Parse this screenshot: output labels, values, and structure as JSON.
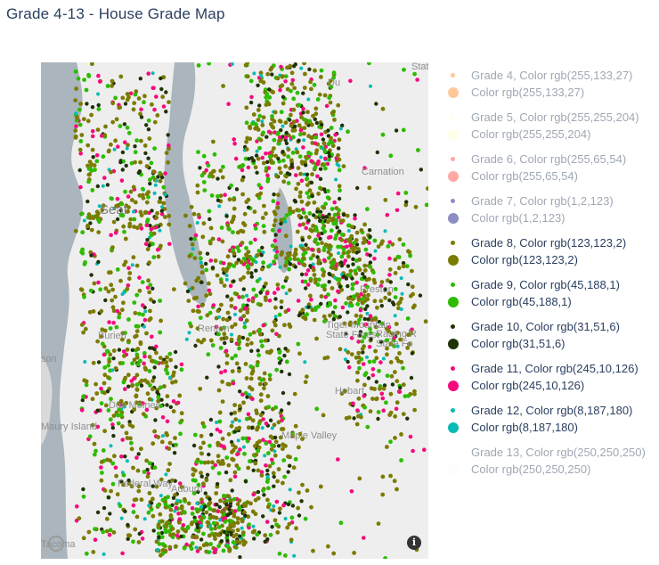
{
  "title": "Grade 4-13 - House Grade Map",
  "map": {
    "background": "#eeeeee",
    "water": "#aab5bd",
    "places": [
      {
        "name": "Stat",
        "size": "small"
      },
      {
        "name": "Du",
        "size": "small"
      },
      {
        "name": "Carnation",
        "size": "small"
      },
      {
        "name": "Seat",
        "size": "big"
      },
      {
        "name": "Preston",
        "size": "small"
      },
      {
        "name": "Tiger Mountain\nState Forest",
        "size": "small"
      },
      {
        "name": "Raging R\nState Fo",
        "size": "small"
      },
      {
        "name": "Renton",
        "size": "small"
      },
      {
        "name": "Burien",
        "size": "small"
      },
      {
        "name": "son",
        "size": "small"
      },
      {
        "name": "Hobart",
        "size": "small"
      },
      {
        "name": "Des Moines",
        "size": "small"
      },
      {
        "name": "Maple Valley",
        "size": "small"
      },
      {
        "name": "Maury Island",
        "size": "small"
      },
      {
        "name": "Federal Way",
        "size": "small"
      },
      {
        "name": "Auburn",
        "size": "small"
      },
      {
        "name": "Tacoma",
        "size": "small"
      }
    ],
    "info_label": "i"
  },
  "legend": [
    {
      "grade_label": "Grade 4, Color rgb(255,133,27)",
      "color_label": "Color rgb(255,133,27)",
      "color": "#ff851b",
      "active": false
    },
    {
      "grade_label": "Grade 5, Color rgb(255,255,204)",
      "color_label": "Color rgb(255,255,204)",
      "color": "#ffffcc",
      "active": false
    },
    {
      "grade_label": "Grade 6, Color rgb(255,65,54)",
      "color_label": "Color rgb(255,65,54)",
      "color": "#ff4136",
      "active": false
    },
    {
      "grade_label": "Grade 7, Color rgb(1,2,123)",
      "color_label": "Color rgb(1,2,123)",
      "color": "#01027b",
      "active": false
    },
    {
      "grade_label": "Grade 8, Color rgb(123,123,2)",
      "color_label": "Color rgb(123,123,2)",
      "color": "#7b7b02",
      "active": true
    },
    {
      "grade_label": "Grade 9, Color rgb(45,188,1)",
      "color_label": "Color rgb(45,188,1)",
      "color": "#2dbc01",
      "active": true
    },
    {
      "grade_label": "Grade 10, Color rgb(31,51,6)",
      "color_label": "Color rgb(31,51,6)",
      "color": "#1f3306",
      "active": true
    },
    {
      "grade_label": "Grade 11, Color rgb(245,10,126)",
      "color_label": "Color rgb(245,10,126)",
      "color": "#f50a7e",
      "active": true
    },
    {
      "grade_label": "Grade 12, Color rgb(8,187,180)",
      "color_label": "Color rgb(8,187,180)",
      "color": "#08bbb4",
      "active": true
    },
    {
      "grade_label": "Grade 13, Color rgb(250,250,250)",
      "color_label": "Color rgb(250,250,250)",
      "color": "#fafafa",
      "active": false
    }
  ]
}
